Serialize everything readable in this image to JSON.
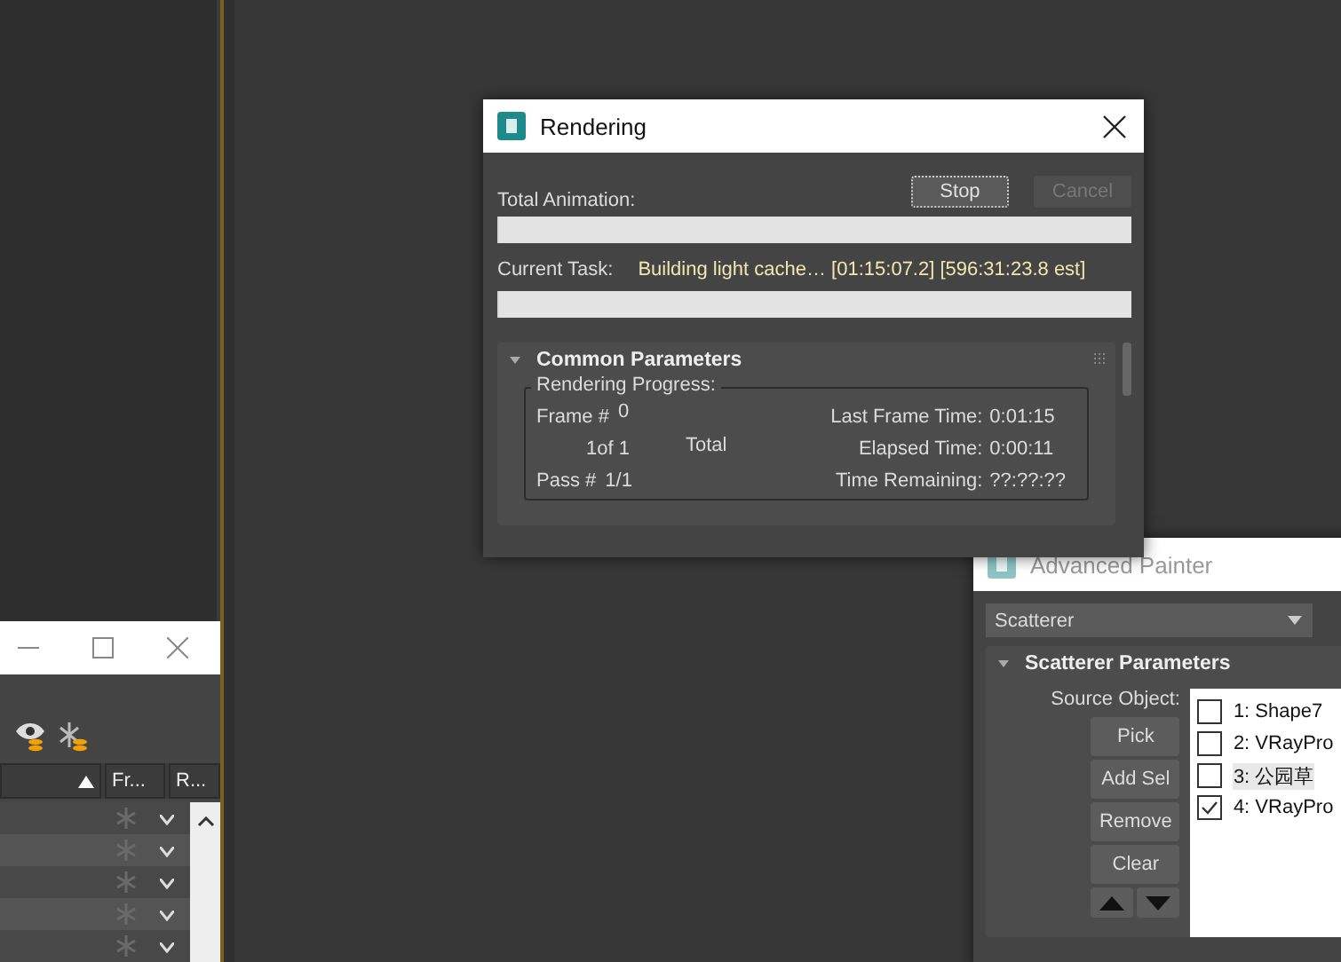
{
  "left_window": {
    "columns": [
      {
        "label": "Fr..."
      },
      {
        "label": "R..."
      }
    ],
    "rows": [
      {
        "frozen": false
      },
      {
        "frozen": false
      },
      {
        "frozen": false
      },
      {
        "frozen": false
      },
      {
        "frozen": false
      }
    ]
  },
  "rendering_window": {
    "title": "Rendering",
    "active": true,
    "buttons": [
      {
        "label": "Stop",
        "disabled": false
      },
      {
        "label": "Cancel",
        "disabled": true
      }
    ],
    "total_animation": {
      "label": "Total Animation:",
      "level": 0
    },
    "current_task": {
      "label": "Current Task:",
      "value": "Building light cache… [01:15:07.2] [596:31:23.8 est]",
      "level": 0
    },
    "rollout": {
      "title": "Common Parameters",
      "expanded": true,
      "group_title": "Rendering Progress:",
      "frame_label": "Frame #",
      "frame_value": "0",
      "count": "1of 1",
      "total_label": "Total",
      "pass_label": "Pass #",
      "pass_value": "1/1",
      "times": [
        {
          "label": "Last Frame Time:",
          "value": "0:01:15"
        },
        {
          "label": "Elapsed Time:",
          "value": "0:00:11"
        },
        {
          "label": "Time Remaining:",
          "value": "??:??:??"
        }
      ]
    }
  },
  "painter_window": {
    "title": "Advanced Painter",
    "active": false,
    "mode": "Scatterer",
    "rollout": {
      "title": "Scatterer Parameters",
      "expanded": true,
      "source_label": "Source Object:",
      "buttons": [
        "Pick",
        "Add Sel",
        "Remove",
        "Clear"
      ],
      "items": [
        {
          "label": "1: Shape7",
          "checked": false,
          "selected": false
        },
        {
          "label": "2: VRayPro",
          "checked": false,
          "selected": false
        },
        {
          "label": "3: 公园草",
          "checked": false,
          "selected": true
        },
        {
          "label": "4: VRayPro",
          "checked": true,
          "selected": false
        }
      ]
    }
  }
}
